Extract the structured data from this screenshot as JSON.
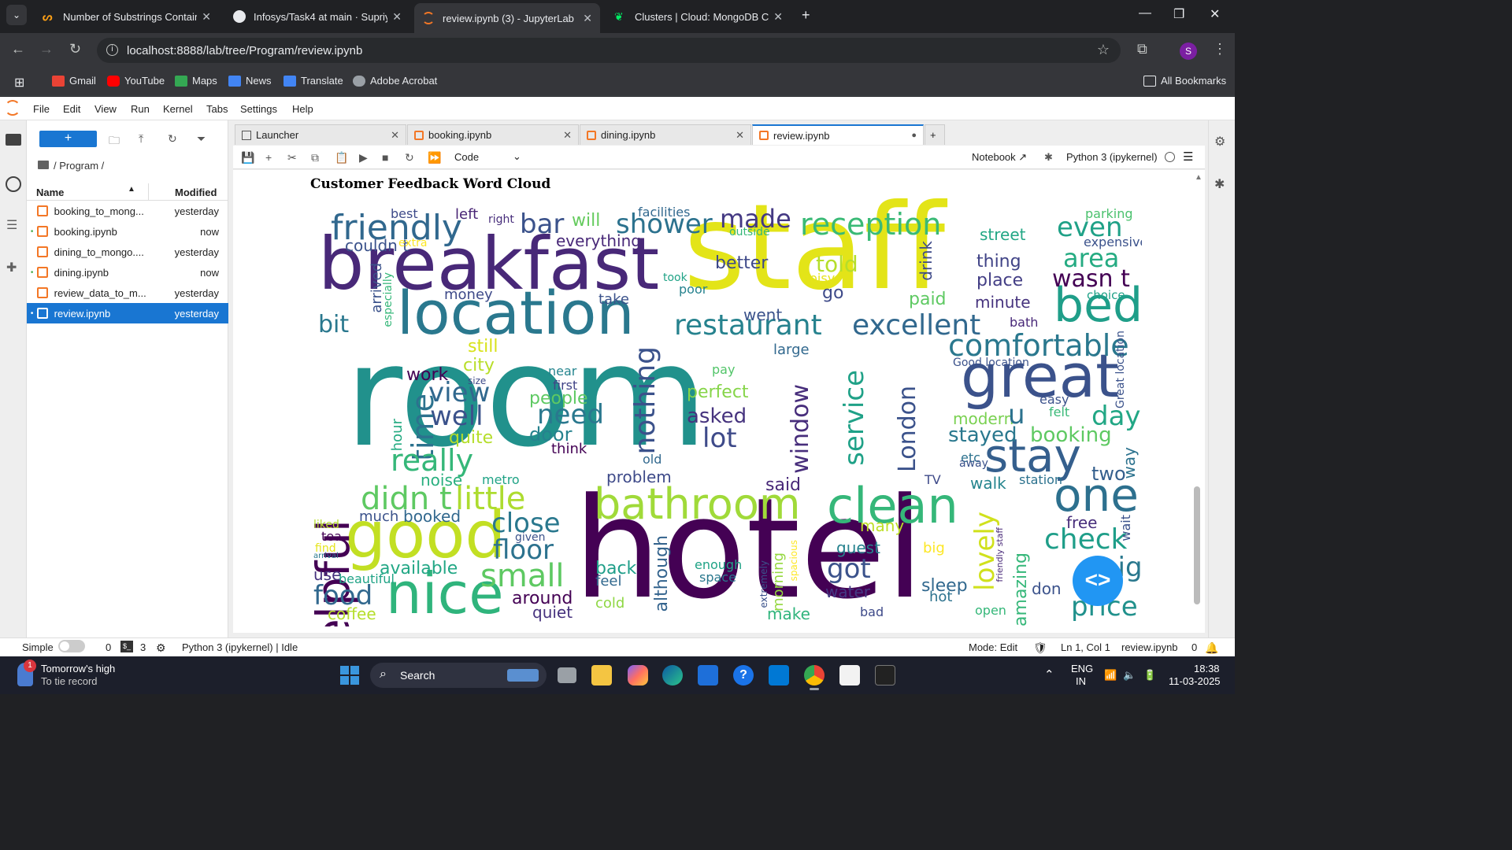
{
  "browser": {
    "tabs": [
      {
        "label": "Number of Substrings Containi",
        "icon": "leetcode-icon",
        "active": false
      },
      {
        "label": "Infosys/Task4 at main · SupriyaG",
        "icon": "github-icon",
        "active": false
      },
      {
        "label": "review.ipynb (3) - JupyterLab",
        "icon": "jupyter-icon",
        "active": true
      },
      {
        "label": "Clusters | Cloud: MongoDB Clo",
        "icon": "mongodb-icon",
        "active": false
      }
    ],
    "url": "localhost:8888/lab/tree/Program/review.ipynb",
    "profile_initial": "S",
    "bookmarks": [
      "Gmail",
      "YouTube",
      "Maps",
      "News",
      "Translate",
      "Adobe Acrobat"
    ],
    "all_bookmarks": "All Bookmarks"
  },
  "jupyter": {
    "menu": [
      "File",
      "Edit",
      "View",
      "Run",
      "Kernel",
      "Tabs",
      "Settings",
      "Help"
    ],
    "breadcrumb": "/ Program /",
    "columns": {
      "name": "Name",
      "modified": "Modified"
    },
    "files": [
      {
        "name": "booking_to_mong...",
        "modified": "yesterday",
        "running": false,
        "selected": false
      },
      {
        "name": "booking.ipynb",
        "modified": "now",
        "running": true,
        "selected": false
      },
      {
        "name": "dining_to_mongo....",
        "modified": "yesterday",
        "running": false,
        "selected": false
      },
      {
        "name": "dining.ipynb",
        "modified": "now",
        "running": true,
        "selected": false
      },
      {
        "name": "review_data_to_m...",
        "modified": "yesterday",
        "running": false,
        "selected": false
      },
      {
        "name": "review.ipynb",
        "modified": "yesterday",
        "running": true,
        "selected": true
      }
    ],
    "doc_tabs": [
      {
        "label": "Launcher",
        "active": false
      },
      {
        "label": "booking.ipynb",
        "active": false
      },
      {
        "label": "dining.ipynb",
        "active": false
      },
      {
        "label": "review.ipynb",
        "active": true
      }
    ],
    "cell_type": "Code",
    "notebook_label": "Notebook",
    "kernel_label": "Python 3 (ipykernel)",
    "output_title": "Customer Feedback Word Cloud",
    "status": {
      "mode_toggle": "Simple",
      "terminals": "0",
      "kernels": "3",
      "kernel_state": "Python 3 (ipykernel) | Idle",
      "mode": "Mode: Edit",
      "cursor": "Ln 1, Col 1",
      "file": "review.ipynb",
      "notifications": "0"
    }
  },
  "wordcloud": {
    "words": [
      {
        "t": "room",
        "c": "#21918c"
      },
      {
        "t": "hotel",
        "c": "#440154"
      },
      {
        "t": "staff",
        "c": "#e3e418"
      },
      {
        "t": "breakfast",
        "c": "#482878"
      },
      {
        "t": "location",
        "c": "#2a788e"
      },
      {
        "t": "good",
        "c": "#c2df23"
      },
      {
        "t": "nice",
        "c": "#2fb47c"
      },
      {
        "t": "great",
        "c": "#3b528b"
      },
      {
        "t": "helpful",
        "c": "#440154"
      },
      {
        "t": "clean",
        "c": "#35b779"
      },
      {
        "t": "bathroom",
        "c": "#a0da39"
      },
      {
        "t": "stay",
        "c": "#355f8d"
      },
      {
        "t": "bed",
        "c": "#1f9e89"
      },
      {
        "t": "one",
        "c": "#2d708e"
      },
      {
        "t": "friendly",
        "c": "#31688e"
      },
      {
        "t": "reception",
        "c": "#3aba76"
      },
      {
        "t": "restaurant",
        "c": "#26828e"
      },
      {
        "t": "excellent",
        "c": "#31688e"
      },
      {
        "t": "comfortable",
        "c": "#2a788e"
      },
      {
        "t": "shower",
        "c": "#2c728e"
      },
      {
        "t": "made",
        "c": "#443983"
      },
      {
        "t": "bar",
        "c": "#3b528b"
      },
      {
        "t": "even",
        "c": "#1fa187"
      },
      {
        "t": "area",
        "c": "#25ab82"
      },
      {
        "t": "wasn t",
        "c": "#440154"
      },
      {
        "t": "street",
        "c": "#22a785"
      },
      {
        "t": "told",
        "c": "#b5de2b"
      },
      {
        "t": "better",
        "c": "#3e4989"
      },
      {
        "t": "thing",
        "c": "#414487"
      },
      {
        "t": "place",
        "c": "#433e85"
      },
      {
        "t": "minute",
        "c": "#46337e"
      },
      {
        "t": "paid",
        "c": "#5ec962"
      },
      {
        "t": "go",
        "c": "#3e4a89"
      },
      {
        "t": "went",
        "c": "#3b528b"
      },
      {
        "t": "couldn t",
        "c": "#3b528b"
      },
      {
        "t": "extra",
        "c": "#fde725"
      },
      {
        "t": "everything",
        "c": "#482878"
      },
      {
        "t": "will",
        "c": "#65cb5e"
      },
      {
        "t": "left",
        "c": "#482475"
      },
      {
        "t": "right",
        "c": "#472d7b"
      },
      {
        "t": "best",
        "c": "#3e4a89"
      },
      {
        "t": "facilities",
        "c": "#31688e"
      },
      {
        "t": "outside",
        "c": "#35b779"
      },
      {
        "t": "parking",
        "c": "#4ac16d"
      },
      {
        "t": "expensive",
        "c": "#3b528b"
      },
      {
        "t": "choice",
        "c": "#1fa187"
      },
      {
        "t": "bath",
        "c": "#482878"
      },
      {
        "t": "money",
        "c": "#3e4a89"
      },
      {
        "t": "take",
        "c": "#3b528b"
      },
      {
        "t": "poor",
        "c": "#26828e"
      },
      {
        "t": "took",
        "c": "#20a386"
      },
      {
        "t": "noisy",
        "c": "#e5e419"
      },
      {
        "t": "bit",
        "c": "#2a788e"
      },
      {
        "t": "still",
        "c": "#d8e219"
      },
      {
        "t": "city",
        "c": "#b8de29"
      },
      {
        "t": "work",
        "c": "#440154"
      },
      {
        "t": "view",
        "c": "#31688e"
      },
      {
        "t": "well",
        "c": "#3b528b"
      },
      {
        "t": "time",
        "c": "#2c728e"
      },
      {
        "t": "hour",
        "c": "#25ab82"
      },
      {
        "t": "quite",
        "c": "#b5de2b"
      },
      {
        "t": "really",
        "c": "#35b779"
      },
      {
        "t": "noise",
        "c": "#29af7f"
      },
      {
        "t": "metro",
        "c": "#20a386"
      },
      {
        "t": "didn t",
        "c": "#5ec962"
      },
      {
        "t": "little",
        "c": "#addc30"
      },
      {
        "t": "much",
        "c": "#3b528b"
      },
      {
        "t": "booked",
        "c": "#31688e"
      },
      {
        "t": "need",
        "c": "#2a788e"
      },
      {
        "t": "people",
        "c": "#5ec962"
      },
      {
        "t": "door",
        "c": "#26828e"
      },
      {
        "t": "think",
        "c": "#440154"
      },
      {
        "t": "near",
        "c": "#25858e"
      },
      {
        "t": "first",
        "c": "#414487"
      },
      {
        "t": "nothing",
        "c": "#3b528b"
      },
      {
        "t": "perfect",
        "c": "#86d549"
      },
      {
        "t": "asked",
        "c": "#46337e"
      },
      {
        "t": "lot",
        "c": "#3e4a89"
      },
      {
        "t": "pay",
        "c": "#52c569"
      },
      {
        "t": "window",
        "c": "#472d7b"
      },
      {
        "t": "service",
        "c": "#1fa187"
      },
      {
        "t": "London",
        "c": "#3b528b"
      },
      {
        "t": "large",
        "c": "#31688e"
      },
      {
        "t": "problem",
        "c": "#3e4a89"
      },
      {
        "t": "said",
        "c": "#482878"
      },
      {
        "t": "old",
        "c": "#31688e"
      },
      {
        "t": "close",
        "c": "#2a788e"
      },
      {
        "t": "floor",
        "c": "#2c728e"
      },
      {
        "t": "small",
        "c": "#5ec962"
      },
      {
        "t": "available",
        "c": "#22a785"
      },
      {
        "t": "food",
        "c": "#31688e"
      },
      {
        "t": "coffee",
        "c": "#b5de2b"
      },
      {
        "t": "around",
        "c": "#440154"
      },
      {
        "t": "quiet",
        "c": "#46327e"
      },
      {
        "t": "back",
        "c": "#1f9e89"
      },
      {
        "t": "feel",
        "c": "#31688e"
      },
      {
        "t": "cold",
        "c": "#8fd744"
      },
      {
        "t": "although",
        "c": "#33638d"
      },
      {
        "t": "morning",
        "c": "#95d840"
      },
      {
        "t": "make",
        "c": "#2fb47c"
      },
      {
        "t": "enough",
        "c": "#20a386"
      },
      {
        "t": "space",
        "c": "#2a788e"
      },
      {
        "t": "got",
        "c": "#3b528b"
      },
      {
        "t": "water",
        "c": "#443983"
      },
      {
        "t": "guest",
        "c": "#26828e"
      },
      {
        "t": "bad",
        "c": "#3e4a89"
      },
      {
        "t": "many",
        "c": "#bddf26"
      },
      {
        "t": "big",
        "c": "#fde725"
      },
      {
        "t": "sleep",
        "c": "#31688e"
      },
      {
        "t": "hot",
        "c": "#2c728e"
      },
      {
        "t": "lovely",
        "c": "#d0e11c"
      },
      {
        "t": "amazing",
        "c": "#35b779"
      },
      {
        "t": "check",
        "c": "#1f9e89"
      },
      {
        "t": "free",
        "c": "#472d7b"
      },
      {
        "t": "night",
        "c": "#2a788e"
      },
      {
        "t": "price",
        "c": "#21918c"
      },
      {
        "t": "don",
        "c": "#3b528b"
      },
      {
        "t": "two",
        "c": "#355f8d"
      },
      {
        "t": "walk",
        "c": "#25858e"
      },
      {
        "t": "station",
        "c": "#2c728e"
      },
      {
        "t": "booking",
        "c": "#5ec962"
      },
      {
        "t": "stayed",
        "c": "#2a788e"
      },
      {
        "t": "modern",
        "c": "#7ad151"
      },
      {
        "t": "day",
        "c": "#22a785"
      },
      {
        "t": "u",
        "c": "#2c728e"
      },
      {
        "t": "easy",
        "c": "#3b528b"
      },
      {
        "t": "felt",
        "c": "#38b977"
      },
      {
        "t": "Good location",
        "c": "#3b528b"
      },
      {
        "t": "Great location",
        "c": "#3b528b"
      },
      {
        "t": "way",
        "c": "#2c728e"
      },
      {
        "t": "wait",
        "c": "#3b528b"
      },
      {
        "t": "drink",
        "c": "#3e4a89"
      },
      {
        "t": "arrived",
        "c": "#3b528b"
      },
      {
        "t": "especially",
        "c": "#35b779"
      },
      {
        "t": "liked",
        "c": "#b5de2b"
      },
      {
        "t": "tea",
        "c": "#440154"
      },
      {
        "t": "use",
        "c": "#46327e"
      },
      {
        "t": "beautiful",
        "c": "#20a386"
      },
      {
        "t": "given",
        "c": "#3b528b"
      },
      {
        "t": "open",
        "c": "#35b779"
      },
      {
        "t": "etc",
        "c": "#2c728e"
      },
      {
        "t": "away",
        "c": "#3b528b"
      },
      {
        "t": "TV",
        "c": "#3e4a89"
      },
      {
        "t": "size",
        "c": "#3e4a89"
      },
      {
        "t": "friendly staff",
        "c": "#482878"
      },
      {
        "t": "extremely",
        "c": "#3b528b"
      },
      {
        "t": "spacious",
        "c": "#fde725"
      },
      {
        "t": "arrival",
        "c": "#2a788e"
      },
      {
        "t": "find",
        "c": "#e5e419"
      }
    ]
  },
  "taskbar": {
    "weather_title": "Tomorrow's high",
    "weather_sub": "To tie record",
    "search": "Search",
    "lang": "ENG",
    "region": "IN",
    "time": "18:38",
    "date": "11-03-2025"
  }
}
